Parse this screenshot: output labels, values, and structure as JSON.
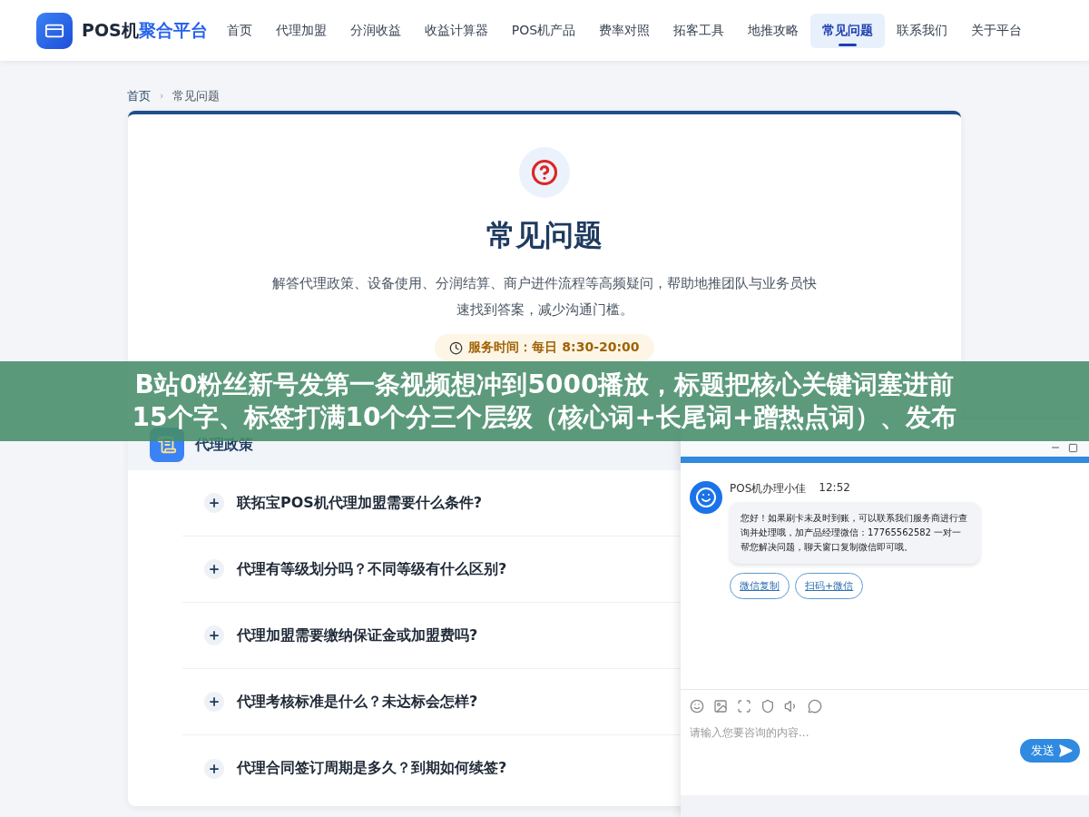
{
  "header": {
    "brand": "POS机",
    "brand_accent": "聚合平台",
    "nav": [
      {
        "label": "首页",
        "selected": false
      },
      {
        "label": "代理加盟",
        "selected": false
      },
      {
        "label": "分润收益",
        "selected": false
      },
      {
        "label": "收益计算器",
        "selected": false
      },
      {
        "label": "POS机产品",
        "selected": false
      },
      {
        "label": "费率对照",
        "selected": false
      },
      {
        "label": "拓客工具",
        "selected": false
      },
      {
        "label": "地推攻略",
        "selected": false
      },
      {
        "label": "常见问题",
        "selected": true
      },
      {
        "label": "联系我们",
        "selected": false
      },
      {
        "label": "关于平台",
        "selected": false
      }
    ]
  },
  "breadcrumb": [
    "首页",
    "常见问题"
  ],
  "breadcrumb_separator": "›",
  "hero": {
    "title": "常见问题",
    "description": "解答代理政策、设备使用、分润结算、商户进件流程等高频疑问，帮助地推团队与业务员快速找到答案，减少沟通门槛。",
    "service_hours": "服务时间：每日 8:30-20:00"
  },
  "section": {
    "title": "代理政策",
    "questions": [
      {
        "text": "联拓宝POS机代理加盟需要什么条件?",
        "expanded": false
      },
      {
        "text": "代理有等级划分吗？不同等级有什么区别?",
        "expanded": false
      },
      {
        "text": "代理加盟需要缴纳保证金或加盟费吗?",
        "expanded": false
      },
      {
        "text": "代理考核标准是什么？未达标会怎样?",
        "expanded": false
      },
      {
        "text": "代理合同签订周期是多久？到期如何续签?",
        "expanded": false
      }
    ]
  },
  "chat": {
    "agent": "POS机办理小佳",
    "time": "12:52",
    "message": "您好！如果刷卡未及时到账，可以联系我们服务商进行查询并处理哦，加产品经理微信：17765562582 一对一帮您解决问题，聊天窗口复制微信即可哦。",
    "actions": [
      "微信复制",
      "扫码+微信"
    ],
    "input": {
      "placeholder": "请输入您要咨询的内容..."
    },
    "send": "发送"
  },
  "banner": {
    "lines": [
      "B站0粉丝新号发第一条视频想冲到5000播放，标题把核心关键词塞进前",
      "15个字、标签打满10个分三个层级（核心词+长尾词+蹭热点词）、发布"
    ]
  }
}
